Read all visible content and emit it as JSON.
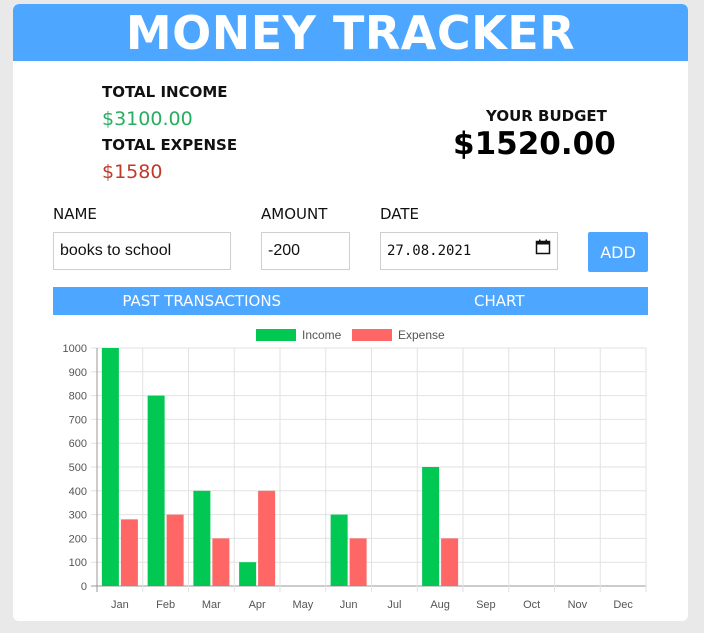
{
  "app": {
    "title": "MONEY TRACKER"
  },
  "summary": {
    "income_label": "TOTAL INCOME",
    "income_value": "$3100.00",
    "expense_label": "TOTAL EXPENSE",
    "expense_value": "$1580",
    "budget_label": "YOUR BUDGET",
    "budget_value": "$1520.00"
  },
  "form": {
    "name_label": "NAME",
    "name_value": "books to school",
    "amount_label": "AMOUNT",
    "amount_value": "-200",
    "date_label": "DATE",
    "date_value": "27.08.2021",
    "add_label": "ADD"
  },
  "tabs": [
    {
      "label": "PAST TRANSACTIONS"
    },
    {
      "label": "CHART"
    }
  ],
  "colors": {
    "accent": "#4da6ff",
    "income": "#00c853",
    "expense": "#ff6666"
  },
  "chart_data": {
    "type": "bar",
    "categories": [
      "Jan",
      "Feb",
      "Mar",
      "Apr",
      "May",
      "Jun",
      "Jul",
      "Aug",
      "Sep",
      "Oct",
      "Nov",
      "Dec"
    ],
    "series": [
      {
        "name": "Income",
        "values": [
          1000,
          800,
          400,
          100,
          0,
          300,
          0,
          500,
          0,
          0,
          0,
          0
        ]
      },
      {
        "name": "Expense",
        "values": [
          280,
          300,
          200,
          400,
          0,
          200,
          0,
          200,
          0,
          0,
          0,
          0
        ]
      }
    ],
    "ylim": [
      0,
      1000
    ],
    "yticks": [
      0,
      100,
      200,
      300,
      400,
      500,
      600,
      700,
      800,
      900,
      1000
    ],
    "grid": true,
    "legend": "top-center"
  }
}
